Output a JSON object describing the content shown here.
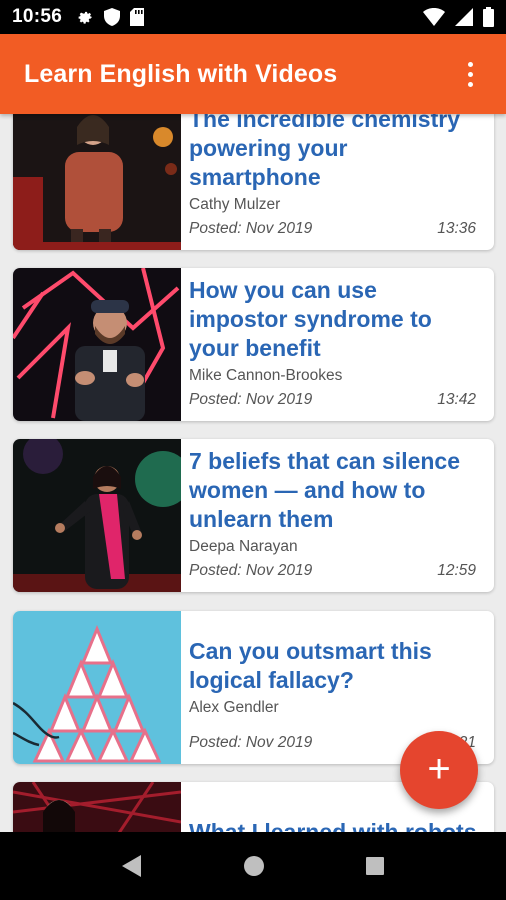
{
  "status_bar": {
    "time": "10:56",
    "left_icons": [
      "gear-icon",
      "shield-icon",
      "sd-card-icon"
    ],
    "right_icons": [
      "wifi-icon",
      "cell-signal-icon",
      "battery-icon"
    ]
  },
  "app_bar": {
    "title": "Learn English with Videos",
    "menu_icon": "more-vert-icon"
  },
  "videos": [
    {
      "title": "The incredible chemistry powering your smartphone",
      "speaker": "Cathy Mulzer",
      "posted": "Posted: Nov 2019",
      "duration": "13:36"
    },
    {
      "title": "How you can use impostor syndrome to your benefit",
      "speaker": "Mike Cannon-Brookes",
      "posted": "Posted: Nov 2019",
      "duration": "13:42"
    },
    {
      "title": "7 beliefs that can silence women — and how to unlearn them",
      "speaker": "Deepa Narayan",
      "posted": "Posted: Nov 2019",
      "duration": "12:59"
    },
    {
      "title": "Can you outsmart this logical fallacy?",
      "speaker": "Alex Gendler",
      "posted": "Posted: Nov 2019",
      "duration": "3:21"
    },
    {
      "title": "What I learned with robots",
      "speaker": "",
      "posted": "",
      "duration": ""
    }
  ],
  "fab": {
    "label": "+",
    "icon": "add-icon"
  },
  "colors": {
    "app_bar": "#f25c24",
    "title_text": "#2a66b4",
    "fab": "#e5452e"
  },
  "nav_bar": {
    "icons": [
      "back-icon",
      "home-icon",
      "recents-icon"
    ]
  }
}
